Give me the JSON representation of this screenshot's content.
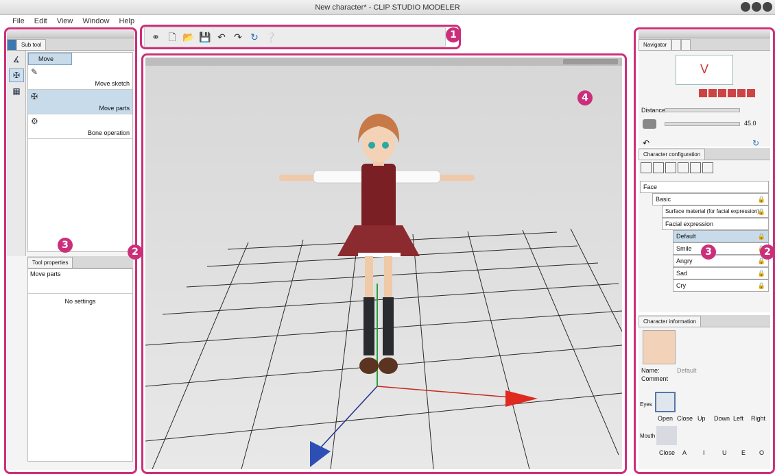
{
  "window": {
    "title": "New character* - CLIP STUDIO MODELER"
  },
  "menu": [
    "File",
    "Edit",
    "View",
    "Window",
    "Help"
  ],
  "left_panel": {
    "subtool_tab": "Sub tool",
    "current_group": "Move",
    "subtools": [
      {
        "label": "Move sketch",
        "icon": "move-sketch-icon",
        "selected": false
      },
      {
        "label": "Move parts",
        "icon": "move-parts-icon",
        "selected": true
      },
      {
        "label": "Bone operation",
        "icon": "bone-operation-icon",
        "selected": false
      }
    ],
    "tool_properties_tab": "Tool properties",
    "tool_properties_title": "Move parts",
    "tool_properties_body": "No settings"
  },
  "toolbar": {
    "icons": [
      "link-icon",
      "new-file-icon",
      "open-file-icon",
      "save-icon",
      "undo-icon",
      "redo-icon",
      "refresh-icon",
      "help-icon"
    ]
  },
  "navigator": {
    "tab": "Navigator",
    "distance_label": "Distance",
    "angle_value": "45.0"
  },
  "character_configuration": {
    "tab": "Character configuration",
    "tree": [
      {
        "label": "Face",
        "level": 0,
        "type": "folder"
      },
      {
        "label": "Basic",
        "level": 1,
        "type": "folder"
      },
      {
        "label": "Surface material (for facial expression)",
        "level": 2,
        "type": "item"
      },
      {
        "label": "Facial expression",
        "level": 2,
        "type": "folder"
      },
      {
        "label": "Default",
        "level": 3,
        "type": "item",
        "selected": true
      },
      {
        "label": "Smile",
        "level": 3,
        "type": "item"
      },
      {
        "label": "Angry",
        "level": 3,
        "type": "item"
      },
      {
        "label": "Sad",
        "level": 3,
        "type": "item"
      },
      {
        "label": "Cry",
        "level": 3,
        "type": "item"
      }
    ]
  },
  "character_information": {
    "tab": "Character information",
    "name_label": "Name:",
    "name_value": "Default",
    "comment_label": "Comment",
    "eyes_label": "Eyes",
    "eye_options": [
      "Open",
      "Close",
      "Up",
      "Down",
      "Left",
      "Right"
    ],
    "mouth_label": "Mouth",
    "mouth_options": [
      "Close",
      "A",
      "I",
      "U",
      "E",
      "O"
    ]
  },
  "callouts": [
    "1",
    "2",
    "3",
    "4",
    "3",
    "2"
  ],
  "colors": {
    "highlight": "#cc2f7a",
    "selection": "#c7dbea"
  }
}
